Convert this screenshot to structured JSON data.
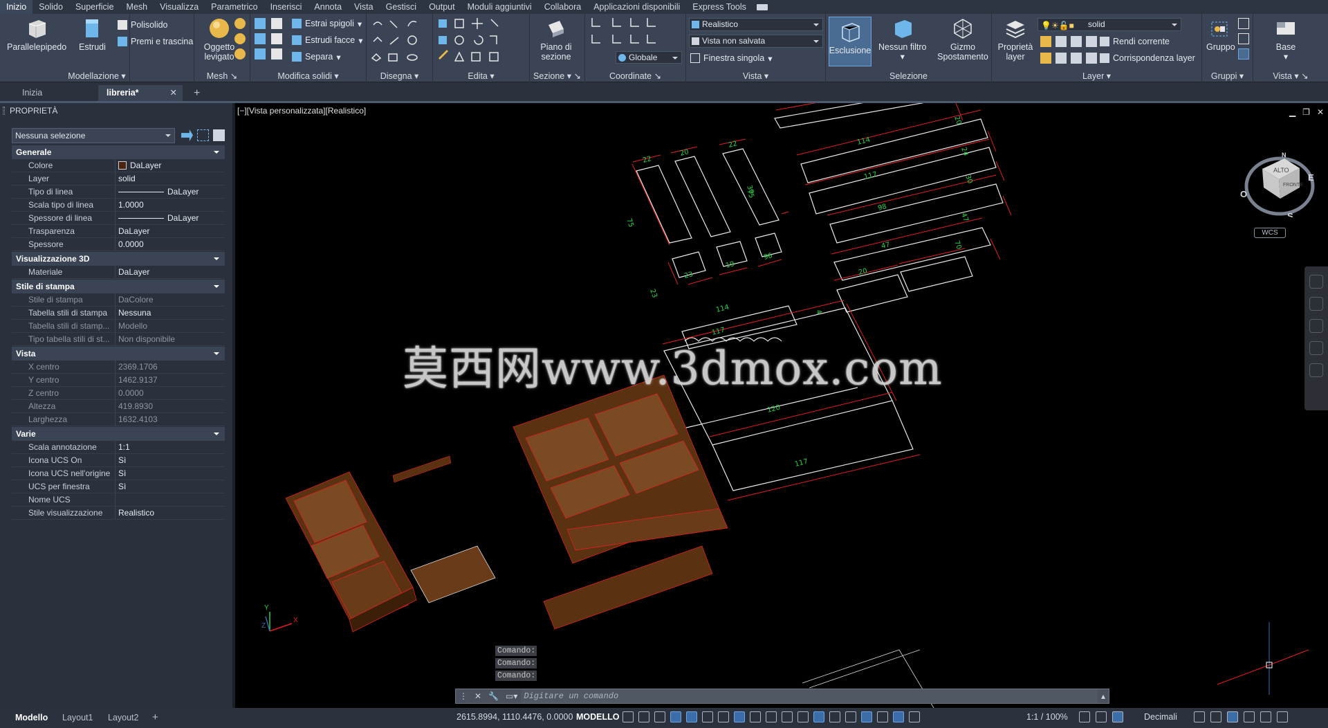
{
  "menu": [
    "Inizio",
    "Solido",
    "Superficie",
    "Mesh",
    "Visualizza",
    "Parametrico",
    "Inserisci",
    "Annota",
    "Vista",
    "Gestisci",
    "Output",
    "Moduli aggiuntivi",
    "Collabora",
    "Applicazioni disponibili",
    "Express Tools"
  ],
  "ribbon": {
    "modellazione": {
      "title": "Modellazione",
      "parallelepipedo": "Parallelepipedo",
      "estrudi": "Estrudi",
      "polisolido": "Polisolido",
      "premi": "Premi e trascina"
    },
    "mesh": {
      "title": "Mesh",
      "oggetto": "Oggetto levigato"
    },
    "modifica": {
      "title": "Modifica solidi",
      "estrai": "Estrai spigoli",
      "estrudi_facce": "Estrudi facce",
      "separa": "Separa"
    },
    "disegna": {
      "title": "Disegna"
    },
    "edita": {
      "title": "Edita"
    },
    "sezione": {
      "title": "Sezione",
      "piano": "Piano di sezione"
    },
    "coordinate": {
      "title": "Coordinate",
      "globale": "Globale"
    },
    "vista": {
      "title": "Vista",
      "stile": "Realistico",
      "vista_salvata": "Vista non salvata",
      "finestra": "Finestra singola"
    },
    "selezione": {
      "title": "Selezione",
      "esclusione": "Esclusione",
      "filtro": "Nessun filtro",
      "gizmo": "Gizmo Spostamento"
    },
    "layer": {
      "title": "Layer",
      "proprieta": "Proprietà layer",
      "layer_name": "solid",
      "rendi": "Rendi corrente",
      "corrisp": "Corrispondenza layer"
    },
    "gruppi": {
      "title": "Gruppi",
      "gruppo": "Gruppo"
    },
    "vista2": {
      "title": "Vista",
      "base": "Base"
    }
  },
  "doctabs": {
    "start": "Inizia",
    "active": "libreria*"
  },
  "properties": {
    "header": "PROPRIETÀ",
    "selection": "Nessuna selezione",
    "sections": [
      {
        "title": "Generale",
        "rows": [
          {
            "k": "Colore",
            "v": "DaLayer",
            "swatch": true
          },
          {
            "k": "Layer",
            "v": "solid"
          },
          {
            "k": "Tipo di linea",
            "v": "DaLayer",
            "line": true
          },
          {
            "k": "Scala tipo di linea",
            "v": "1.0000"
          },
          {
            "k": "Spessore di linea",
            "v": "DaLayer",
            "line": true
          },
          {
            "k": "Trasparenza",
            "v": "DaLayer"
          },
          {
            "k": "Spessore",
            "v": "0.0000"
          }
        ]
      },
      {
        "title": "Visualizzazione 3D",
        "rows": [
          {
            "k": "Materiale",
            "v": "DaLayer"
          }
        ]
      },
      {
        "title": "Stile di stampa",
        "rows": [
          {
            "k": "Stile di stampa",
            "v": "DaColore",
            "dim": true
          },
          {
            "k": "Tabella stili di stampa",
            "v": "Nessuna"
          },
          {
            "k": "Tabella stili di stamp...",
            "v": "Modello",
            "dim": true
          },
          {
            "k": "Tipo tabella stili di st...",
            "v": "Non disponibile",
            "dim": true
          }
        ]
      },
      {
        "title": "Vista",
        "rows": [
          {
            "k": "X centro",
            "v": "2369.1706",
            "dim": true
          },
          {
            "k": "Y centro",
            "v": "1462.9137",
            "dim": true
          },
          {
            "k": "Z centro",
            "v": "0.0000",
            "dim": true
          },
          {
            "k": "Altezza",
            "v": "419.8930",
            "dim": true
          },
          {
            "k": "Larghezza",
            "v": "1632.4103",
            "dim": true
          }
        ]
      },
      {
        "title": "Varie",
        "rows": [
          {
            "k": "Scala annotazione",
            "v": "1:1"
          },
          {
            "k": "Icona UCS On",
            "v": "Sì"
          },
          {
            "k": "Icona UCS nell'origine",
            "v": "Sì"
          },
          {
            "k": "UCS per finestra",
            "v": "Sì"
          },
          {
            "k": "Nome UCS",
            "v": ""
          },
          {
            "k": "Stile visualizzazione",
            "v": "Realistico"
          }
        ]
      }
    ]
  },
  "viewport": {
    "label": "[−][Vista personalizzata][Realistico]",
    "watermark": "莫西网www.3dmox.com",
    "viewcube": {
      "top": "ALTO",
      "front": "FRONTE",
      "e": "E",
      "s": "S",
      "o": "O",
      "n": "N"
    },
    "wcs": "WCS",
    "dims": [
      "22",
      "20",
      "22",
      "114",
      "20",
      "117",
      "24",
      "98",
      "30",
      "47",
      "47",
      "20",
      "70",
      "75",
      "75",
      "30",
      "23",
      "23",
      "19",
      "96",
      "114",
      "117",
      "120",
      "117",
      "4"
    ]
  },
  "command": {
    "history": [
      "Comando:",
      "Comando:",
      "Comando:"
    ],
    "placeholder": "Digitare un comando"
  },
  "status": {
    "layouts": [
      "Modello",
      "Layout1",
      "Layout2"
    ],
    "coords": "2615.8994, 1110.4476, 0.0000",
    "model": "MODELLO",
    "scale": "1:1 / 100%",
    "units": "Decimali"
  },
  "colors": {
    "accent": "#3b6ea8",
    "furniture": "#5a3212",
    "dimension": "#e02020",
    "dimtext": "#29d24a"
  }
}
